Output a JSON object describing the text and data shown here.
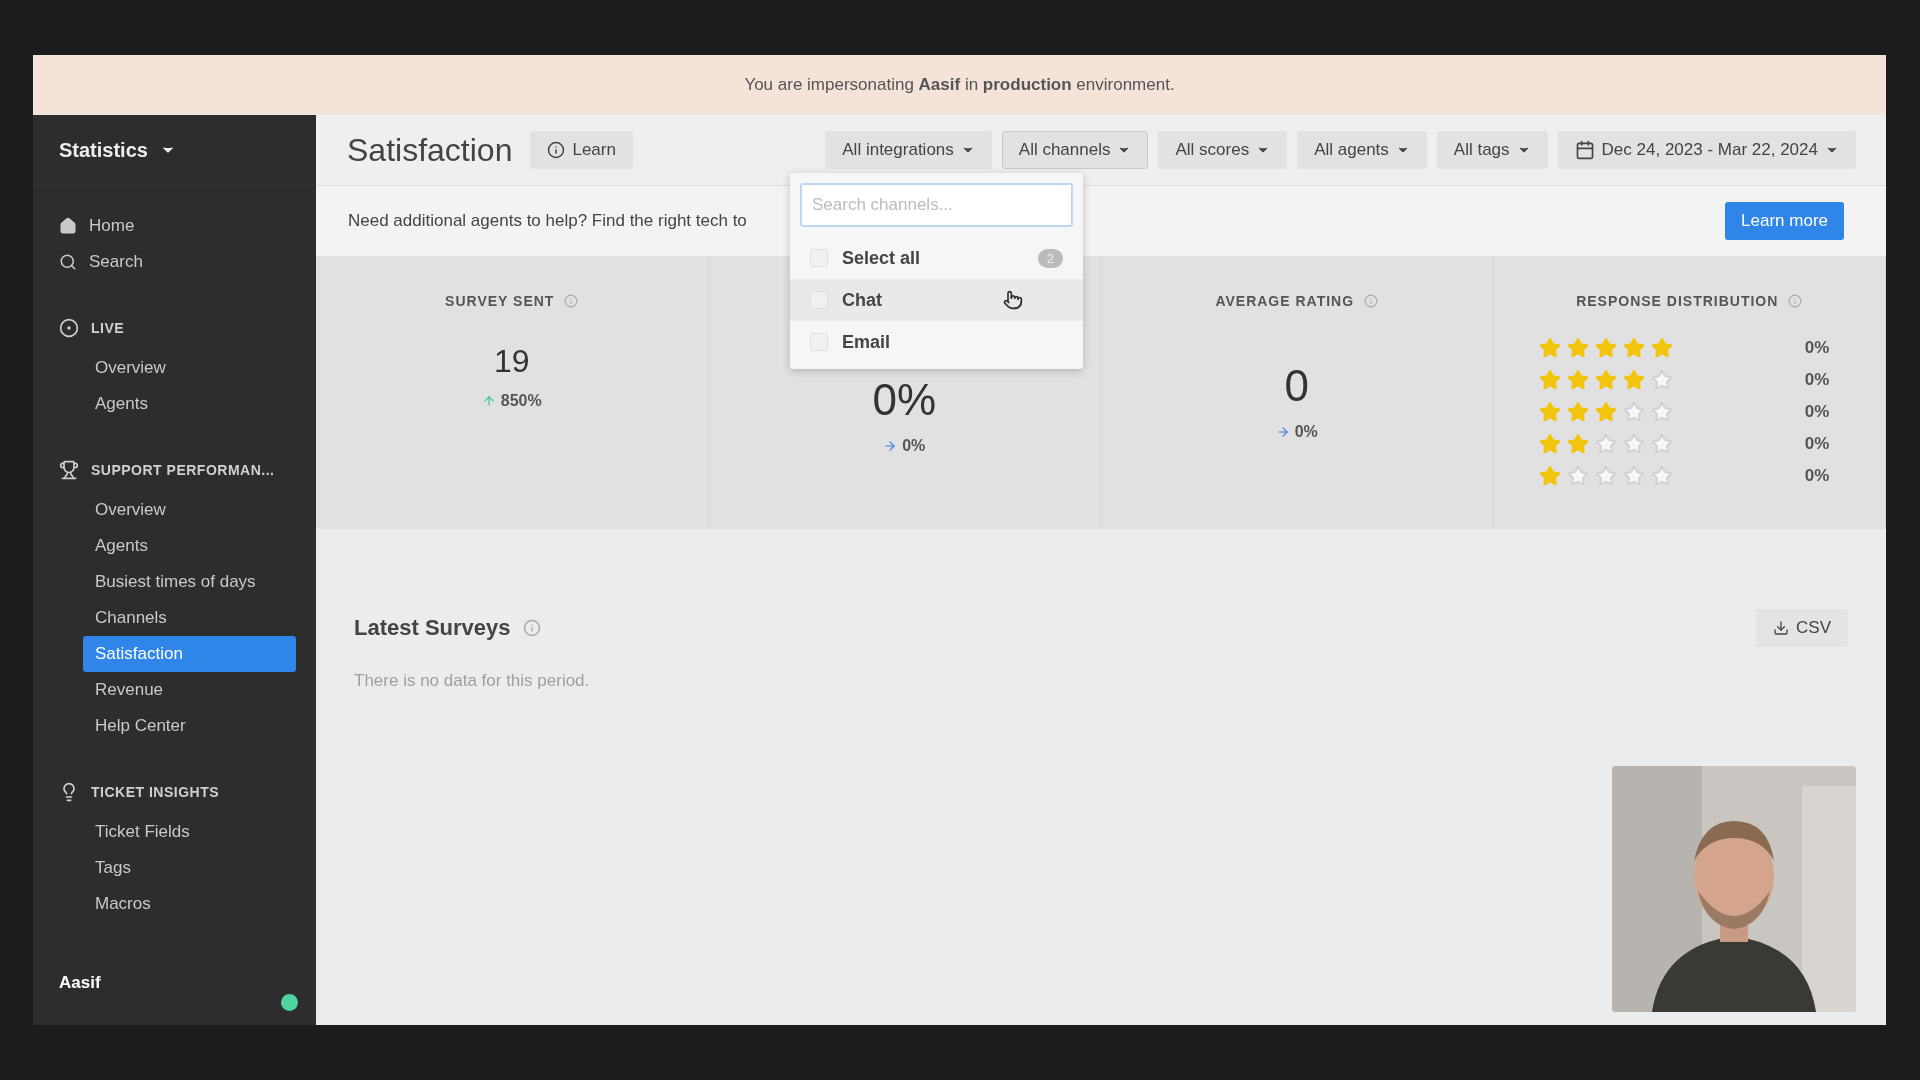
{
  "banner": {
    "text": "You are impersonating **Aasif** in **production** environment."
  },
  "sidebar": {
    "title": "Statistics",
    "top_items": [
      {
        "label": "Home",
        "selected": false
      },
      {
        "label": "Search",
        "selected": false
      }
    ],
    "sections": [
      {
        "title": "LIVE",
        "items": [
          {
            "label": "Overview",
            "selected": false
          },
          {
            "label": "Agents",
            "selected": false
          }
        ]
      },
      {
        "title": "SUPPORT PERFORMAN...",
        "items": [
          {
            "label": "Overview",
            "selected": false
          },
          {
            "label": "Agents",
            "selected": false
          },
          {
            "label": "Busiest times of days",
            "selected": false
          },
          {
            "label": "Channels",
            "selected": false
          },
          {
            "label": "Satisfaction",
            "selected": true
          },
          {
            "label": "Revenue",
            "selected": false
          },
          {
            "label": "Help Center",
            "selected": false
          }
        ]
      },
      {
        "title": "TICKET INSIGHTS",
        "items": [
          {
            "label": "Ticket Fields",
            "selected": false
          },
          {
            "label": "Tags",
            "selected": false
          },
          {
            "label": "Macros",
            "selected": false
          }
        ]
      }
    ],
    "user": {
      "name": "Aasif",
      "online": true
    }
  },
  "header": {
    "title": "Satisfaction",
    "learn_button": "Learn",
    "filters": [
      {
        "label": "All integrations",
        "kind": "select",
        "expanded": false
      },
      {
        "label": "All channels",
        "kind": "select",
        "expanded": true
      },
      {
        "label": "All scores",
        "kind": "select",
        "expanded": false
      },
      {
        "label": "All agents",
        "kind": "select",
        "expanded": false
      },
      {
        "label": "All tags",
        "kind": "select",
        "expanded": false
      },
      {
        "label": "Dec 24, 2023 - Mar 22, 2024",
        "kind": "date",
        "expanded": false
      }
    ]
  },
  "channels_dropdown": {
    "placeholder": "Search channels...",
    "select_all": {
      "label": "Select all",
      "count": "2",
      "checked": false
    },
    "options": [
      {
        "label": "Chat",
        "checked": false,
        "hovered": true
      },
      {
        "label": "Email",
        "checked": false,
        "hovered": false
      }
    ]
  },
  "notice": {
    "text": "Need additional agents to help? Find the right tech to",
    "button": "Learn more"
  },
  "stats": [
    {
      "title": "SURVEY SENT",
      "value": "19",
      "change": "850%",
      "kind": "up"
    },
    {
      "value": "0%",
      "change": "0%",
      "kind": "flat"
    },
    {
      "title": "AVERAGE RATING",
      "value": "0",
      "change": "0%",
      "kind": "flat"
    }
  ],
  "distribution": {
    "title": "RESPONSE DISTRIBUTION",
    "rows": [
      {
        "stars": 5,
        "percent": "0%"
      },
      {
        "stars": 4,
        "percent": "0%"
      },
      {
        "stars": 3,
        "percent": "0%"
      },
      {
        "stars": 2,
        "percent": "0%"
      },
      {
        "stars": 1,
        "percent": "0%"
      }
    ]
  },
  "latest_surveys": {
    "title": "Latest Surveys",
    "empty_text": "There is no data for this period.",
    "csv_button": "CSV"
  }
}
